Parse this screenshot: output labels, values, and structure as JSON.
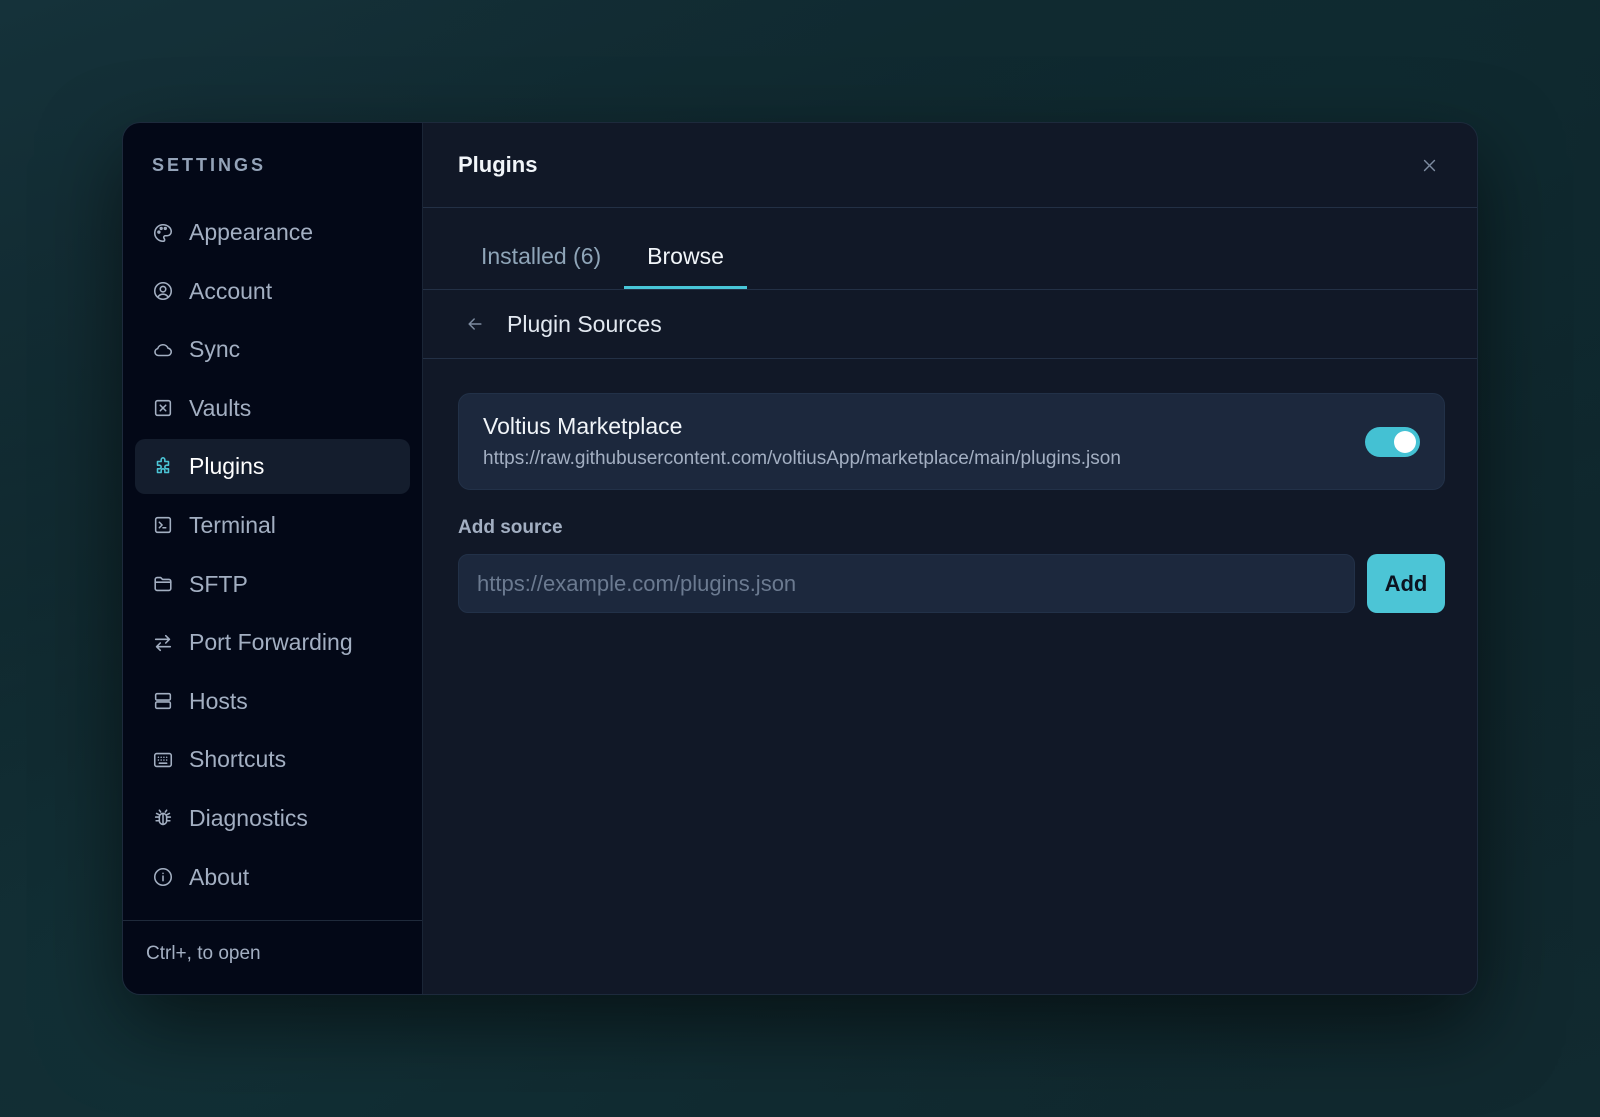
{
  "sidebar": {
    "title": "SETTINGS",
    "items": [
      {
        "label": "Appearance",
        "icon": "palette-icon",
        "active": false
      },
      {
        "label": "Account",
        "icon": "user-circle-icon",
        "active": false
      },
      {
        "label": "Sync",
        "icon": "cloud-icon",
        "active": false
      },
      {
        "label": "Vaults",
        "icon": "vault-icon",
        "active": false
      },
      {
        "label": "Plugins",
        "icon": "puzzle-icon",
        "active": true
      },
      {
        "label": "Terminal",
        "icon": "terminal-icon",
        "active": false
      },
      {
        "label": "SFTP",
        "icon": "folder-icon",
        "active": false
      },
      {
        "label": "Port Forwarding",
        "icon": "arrows-swap-icon",
        "active": false
      },
      {
        "label": "Hosts",
        "icon": "server-icon",
        "active": false
      },
      {
        "label": "Shortcuts",
        "icon": "keyboard-icon",
        "active": false
      },
      {
        "label": "Diagnostics",
        "icon": "bug-icon",
        "active": false
      },
      {
        "label": "About",
        "icon": "info-icon",
        "active": false
      }
    ],
    "footer": "Ctrl+, to open"
  },
  "header": {
    "title": "Plugins",
    "close_icon": "close-icon"
  },
  "tabs": [
    {
      "label": "Installed (6)",
      "active": false
    },
    {
      "label": "Browse",
      "active": true
    }
  ],
  "subheader": {
    "title": "Plugin Sources",
    "back_icon": "arrow-left-icon"
  },
  "sources": [
    {
      "name": "Voltius Marketplace",
      "url": "https://raw.githubusercontent.com/voltiusApp/marketplace/main/plugins.json",
      "enabled": true
    }
  ],
  "add_source": {
    "label": "Add source",
    "placeholder": "https://example.com/plugins.json",
    "value": "",
    "button_label": "Add"
  },
  "colors": {
    "accent": "#4cc5d6",
    "sidebar_bg": "#030817",
    "main_bg": "#111827",
    "card_bg": "#1c283d"
  }
}
